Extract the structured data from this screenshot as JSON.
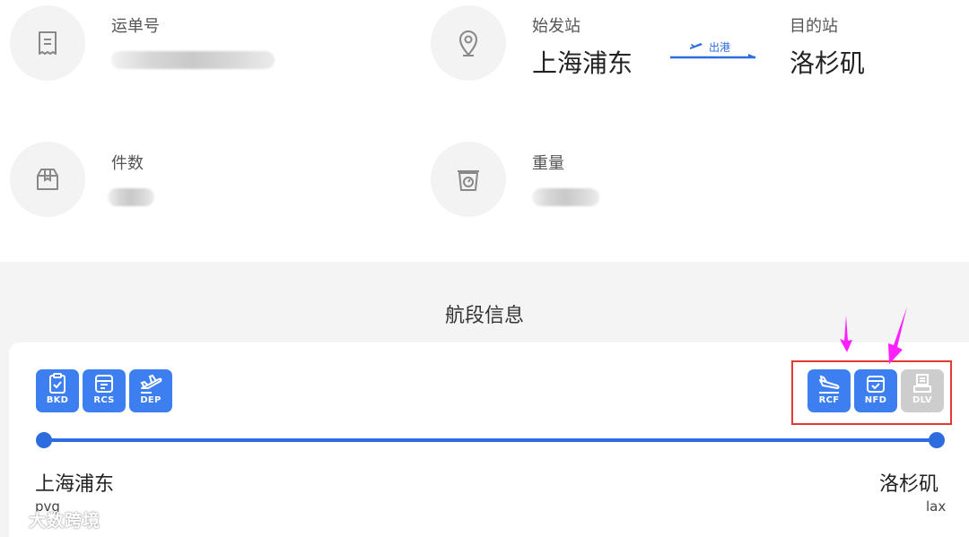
{
  "info": {
    "waybill_label": "运单号",
    "origin_label": "始发站",
    "origin_city": "上海浦东",
    "direction_label": "出港",
    "destination_label": "目的站",
    "destination_city": "洛杉矶",
    "pieces_label": "件数",
    "weight_label": "重量"
  },
  "segment": {
    "title": "航段信息",
    "left_statuses": [
      {
        "code": "BKD",
        "icon": "clipboard-check-icon",
        "state": "done"
      },
      {
        "code": "RCS",
        "icon": "package-icon",
        "state": "done"
      },
      {
        "code": "DEP",
        "icon": "plane-takeoff-icon",
        "state": "done"
      }
    ],
    "right_statuses": [
      {
        "code": "RCF",
        "icon": "plane-landing-icon",
        "state": "done"
      },
      {
        "code": "NFD",
        "icon": "calendar-check-icon",
        "state": "done"
      },
      {
        "code": "DLV",
        "icon": "delivery-icon",
        "state": "pending"
      }
    ],
    "start_city": "上海浦东",
    "start_code": "pvg",
    "end_city": "洛杉矶",
    "end_code": "lax"
  },
  "watermark": "大数跨境",
  "colors": {
    "accent": "#2d6cdf",
    "status_done": "#3d7ff0",
    "status_pending": "#cdcdcd",
    "highlight": "#e53935",
    "arrow": "#ff1fff"
  }
}
